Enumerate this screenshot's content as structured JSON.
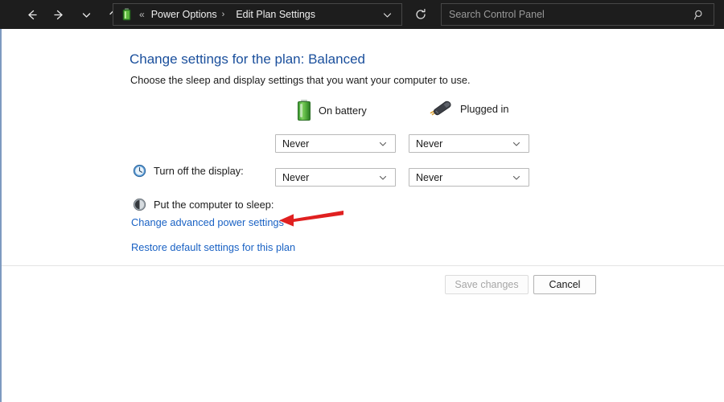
{
  "titlebar": {
    "nav": {
      "back_label": "Back",
      "forward_label": "Forward",
      "recent_label": "Recent locations",
      "up_label": "Up one level"
    },
    "address": {
      "icon": "battery-icon",
      "overflow_separator": "«",
      "crumb_separator": "›",
      "crumbs": [
        {
          "label": "Power Options"
        },
        {
          "label": "Edit Plan Settings"
        }
      ],
      "dropdown_icon": "chevron-down-icon"
    },
    "refresh_icon": "refresh-icon",
    "search": {
      "placeholder": "Search Control Panel",
      "value": "",
      "icon": "search-icon"
    }
  },
  "main": {
    "title": "Change settings for the plan: Balanced",
    "subtitle": "Choose the sleep and display settings that you want your computer to use.",
    "columns": [
      {
        "id": "battery",
        "label": "On battery",
        "icon": "battery-icon"
      },
      {
        "id": "plugged",
        "label": "Plugged in",
        "icon": "power-plug-icon"
      }
    ],
    "rows": [
      {
        "id": "turn-off-display",
        "label": "Turn off the display:",
        "icon": "clock-icon",
        "battery_value": "Never",
        "plugged_value": "Never"
      },
      {
        "id": "put-computer-to-sleep",
        "label": "Put the computer to sleep:",
        "icon": "moon-icon",
        "battery_value": "Never",
        "plugged_value": "Never"
      }
    ],
    "links": [
      {
        "id": "advanced",
        "label": "Change advanced power settings"
      },
      {
        "id": "restore",
        "label": "Restore default settings for this plan"
      }
    ],
    "annotation": {
      "type": "arrow",
      "direction": "left",
      "color": "#e02020",
      "points_at": "Change advanced power settings"
    }
  },
  "footer": {
    "save_label": "Save changes",
    "save_enabled": false,
    "cancel_label": "Cancel",
    "cancel_enabled": true
  },
  "colors": {
    "titlebar_bg": "#1d1d1d",
    "link_blue": "#1a62c4",
    "heading_blue": "#1a4f9c",
    "annotation_red": "#e02020",
    "frame_blue": "#7e9ac0"
  }
}
